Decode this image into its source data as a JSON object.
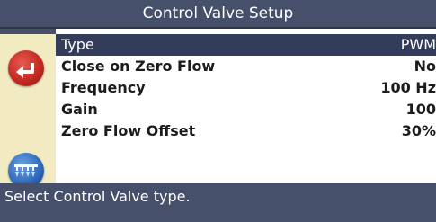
{
  "window": {
    "title": "Control Valve Setup"
  },
  "settings": [
    {
      "label": "Type",
      "value": "PWM"
    },
    {
      "label": "Close on Zero Flow",
      "value": "No"
    },
    {
      "label": "Frequency",
      "value": "100 Hz"
    },
    {
      "label": "Gain",
      "value": "100"
    },
    {
      "label": "Zero Flow Offset",
      "value": "30%"
    }
  ],
  "selected_index": 0,
  "status": {
    "message": "Select Control Valve type."
  },
  "icons": {
    "back": "back-arrow-icon",
    "spray": "sprayer-boom-icon"
  },
  "colors": {
    "title_bar": "#47506a",
    "selection": "#333c5a",
    "sidebar": "#f2ebc2",
    "back_button": "#c42a22",
    "spray_button": "#2d66b8"
  }
}
